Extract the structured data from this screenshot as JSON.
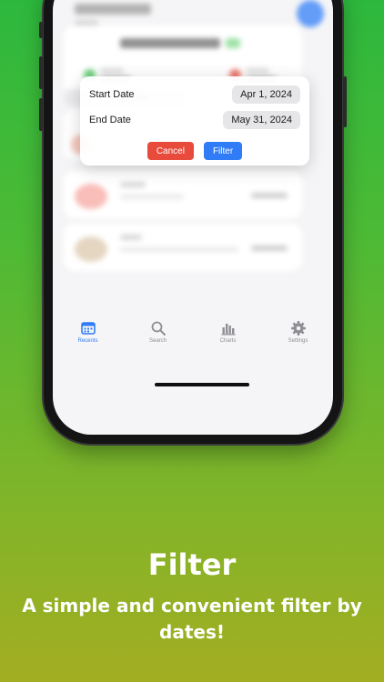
{
  "filter_dialog": {
    "start_label": "Start Date",
    "start_value": "Apr 1, 2024",
    "end_label": "End Date",
    "end_value": "May 31, 2024",
    "cancel_label": "Cancel",
    "filter_label": "Filter"
  },
  "tabbar": {
    "items": [
      {
        "label": "Recents",
        "icon": "calendar-icon",
        "active": true
      },
      {
        "label": "Search",
        "icon": "search-icon"
      },
      {
        "label": "Charts",
        "icon": "bar-chart-icon"
      },
      {
        "label": "Settings",
        "icon": "gear-icon"
      }
    ]
  },
  "caption": {
    "title": "Filter",
    "subtitle": "A simple and convenient filter by dates!"
  },
  "colors": {
    "accent": "#2f7cf6",
    "cancel": "#e84a3b",
    "background_top": "#2db83d",
    "background_bottom": "#a3ae22"
  }
}
